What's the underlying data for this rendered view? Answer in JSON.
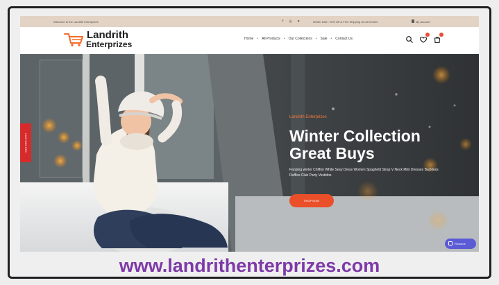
{
  "topbar": {
    "welcome": "Welcome to the Landrith Enterprizes",
    "social": [
      "f",
      "◎",
      "♥"
    ],
    "promo": "Winter Sale : 20% Off & Free Shipping On All Orders",
    "account": "My account"
  },
  "nav": {
    "logo_line1": "Landrith",
    "logo_line2": "Enterprizes",
    "menu": [
      "Home",
      "All Products",
      "Our Collections",
      "Sale",
      "Contact Us"
    ],
    "icons": [
      "search-icon",
      "wishlist-icon",
      "cart-icon"
    ]
  },
  "hero": {
    "side_tab": "GET 20% OFF!",
    "brand": "Landrith Enterprizes",
    "title_line1": "Winter Collection",
    "title_line2": "Great Buys",
    "description": "Fanping winter Chiffon White Sexy Dress Women Spaghetti Strap V Neck Mini Dresses Backless Ruffles Club Party Vestidos",
    "button": "SHOP NOW"
  },
  "widget": {
    "label": "Rewards"
  },
  "footer": {
    "url": "www.landrithenterprizes.com"
  },
  "colors": {
    "topbar_bg": "#e3d3c4",
    "accent_orange": "#ea4f2a",
    "side_tab_red": "#d72b2b",
    "url_purple": "#7e39a7",
    "rewards_blue": "#5b5bd6"
  }
}
